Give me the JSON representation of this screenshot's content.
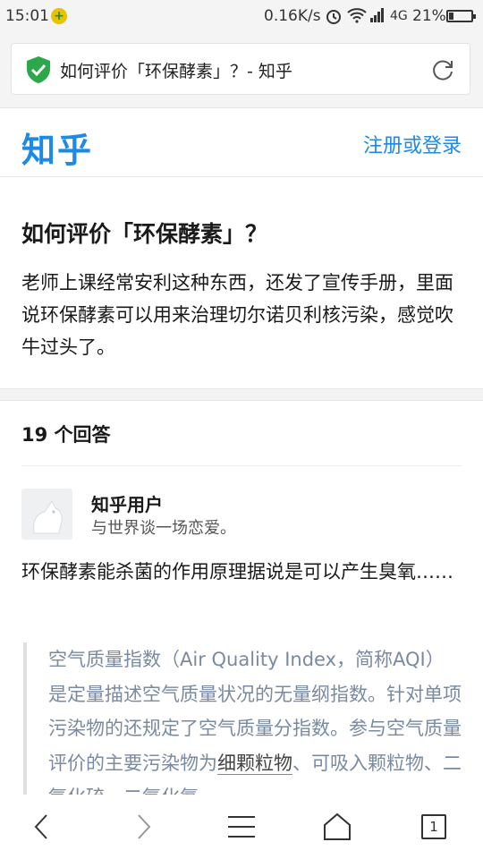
{
  "status_bar": {
    "time": "15:01",
    "net_speed": "0.16K/s",
    "network": "4G",
    "battery_pct": "21%",
    "battery_level": 0.21
  },
  "browser": {
    "page_title": "如何评价「环保酵素」？- 知乎"
  },
  "header": {
    "logo": "知乎",
    "login": "注册或登录"
  },
  "question": {
    "title": "如何评价「环保酵素」？",
    "description": "老师上课经常安利这种东西，还发了宣传手册，里面说环保酵素可以用来治理切尔诺贝利核污染，感觉吹牛过头了。"
  },
  "answers": {
    "count_label": "19 个回答",
    "first": {
      "author": "知乎用户",
      "bio": "与世界谈一场恋爱。",
      "excerpt": "环保酵素能杀菌的作用原理据说是可以产生臭氧……",
      "quote_text": "空气质量指数（Air Quality Index，简称AQI）是定量描述空气质量状况的无量纲指数。针对单项污染物的还规定了空气质量分指数。参与空气质量评价的主要污染物为",
      "quote_link": "细颗粒物",
      "quote_tail": "、可吸入颗粒物、二氧化硫、二氧化氮"
    }
  },
  "bottom_nav": {
    "tab_count": "1"
  },
  "colors": {
    "brand": "#1e8ae6",
    "shield": "#2aa84a",
    "quote_text": "#7a8aa0"
  }
}
